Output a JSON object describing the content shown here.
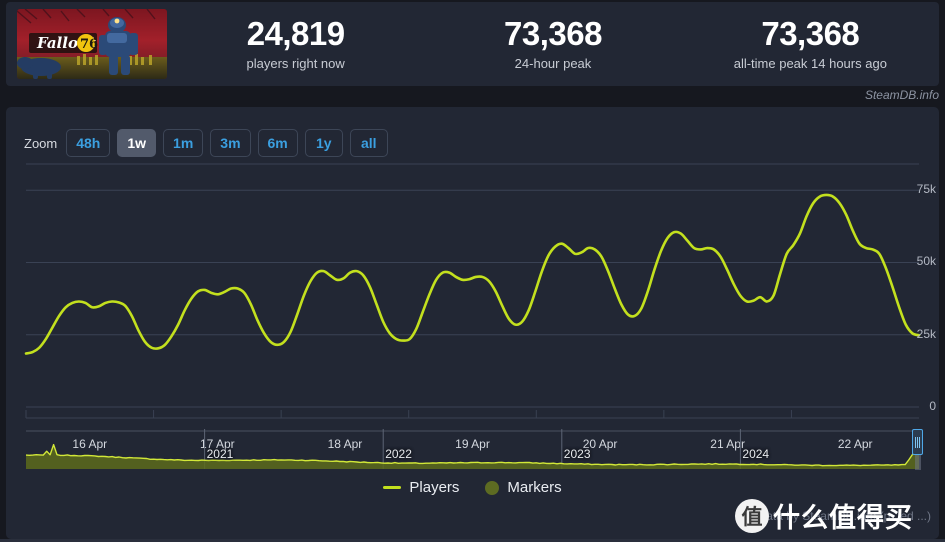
{
  "header": {
    "game_thumbnail": {
      "name": "fallout-76-capsule",
      "title_text": "Fallout",
      "badge_text": "76"
    },
    "stats": [
      {
        "value": "24,819",
        "label": "players right now"
      },
      {
        "value": "73,368",
        "label": "24-hour peak"
      },
      {
        "value": "73,368",
        "label": "all-time peak 14 hours ago"
      }
    ]
  },
  "watermark_link": "SteamDB.info",
  "chart_panel": {
    "zoom": {
      "label": "Zoom",
      "buttons": [
        {
          "label": "48h",
          "active": false
        },
        {
          "label": "1w",
          "active": true
        },
        {
          "label": "1m",
          "active": false
        },
        {
          "label": "3m",
          "active": false
        },
        {
          "label": "6m",
          "active": false
        },
        {
          "label": "1y",
          "active": false
        },
        {
          "label": "all",
          "active": false
        }
      ]
    },
    "legend": [
      {
        "label": "Players",
        "marker": "line",
        "color": "#c3e01e"
      },
      {
        "label": "Markers",
        "marker": "dot",
        "color": "#5d6b22"
      }
    ],
    "credit": "data by SteamDB.info (p...ed ...)",
    "navigator": {
      "years": [
        "2021",
        "2022",
        "2023",
        "2024"
      ],
      "handle_position": "right"
    }
  },
  "smzdm_watermark": {
    "badge": "值",
    "text": "什么值得买"
  },
  "chart_data": {
    "type": "line",
    "title": "",
    "xlabel": "",
    "ylabel": "",
    "ylim": [
      0,
      82000
    ],
    "yticks": [
      0,
      25000,
      50000,
      75000
    ],
    "ytick_labels": [
      "0",
      "25k",
      "50k",
      "75k"
    ],
    "grid": true,
    "legend_position": "bottom",
    "xtick_labels": [
      "16 Apr",
      "17 Apr",
      "18 Apr",
      "19 Apr",
      "20 Apr",
      "21 Apr",
      "22 Apr"
    ],
    "series": [
      {
        "name": "Players",
        "color": "#c3e01e",
        "values": [
          18500,
          19000,
          20500,
          23500,
          27500,
          31500,
          34500,
          36000,
          36500,
          36000,
          34500,
          34800,
          36000,
          36500,
          36200,
          35000,
          31500,
          26500,
          22500,
          20500,
          20300,
          21500,
          24500,
          28500,
          33500,
          37500,
          40000,
          40500,
          39500,
          39000,
          39800,
          41000,
          41000,
          39500,
          35500,
          30000,
          25500,
          22500,
          21500,
          22500,
          26000,
          32000,
          38500,
          43500,
          46500,
          47000,
          45500,
          44000,
          44500,
          46500,
          47000,
          45500,
          41500,
          35500,
          29500,
          25500,
          23500,
          23000,
          23500,
          27000,
          33000,
          39000,
          44000,
          46500,
          46500,
          45000,
          44000,
          44200,
          45000,
          45000,
          43500,
          40000,
          35000,
          30500,
          28500,
          29500,
          33500,
          40000,
          47000,
          52500,
          55500,
          56500,
          55000,
          53000,
          53500,
          55000,
          54500,
          52000,
          47000,
          41000,
          35500,
          32000,
          31500,
          34000,
          40000,
          47500,
          54000,
          58500,
          60500,
          60000,
          57500,
          55000,
          54500,
          55000,
          54500,
          52000,
          47500,
          42500,
          38500,
          36500,
          36800,
          38000,
          36500,
          38500,
          46000,
          53000,
          56000,
          60000,
          66000,
          70500,
          72800,
          73368,
          72800,
          70500,
          66500,
          61000,
          56500,
          55000,
          54500,
          53000,
          48000,
          41500,
          34500,
          28500,
          25500,
          24819
        ]
      }
    ],
    "annotations": {
      "all_time_peak": 73368,
      "current": 24819,
      "24h_peak": 73368
    },
    "navigator_overview": {
      "x_years": [
        "2021",
        "2022",
        "2023",
        "2024"
      ],
      "description": "multi-year player count overview, declining from 2020 spike then gradual flattening with a spike at far right"
    }
  }
}
